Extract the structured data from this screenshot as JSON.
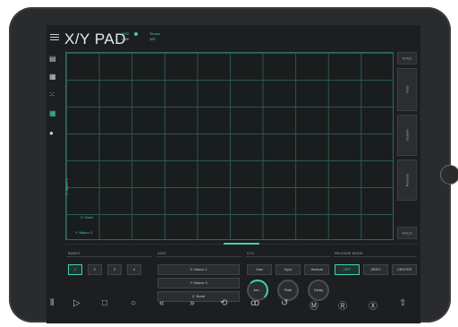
{
  "header": {
    "title": "X/Y PAD",
    "status_label": "MIDI",
    "status_value": "LIVE",
    "tempo_label": "Tempo",
    "tempo_value": "127"
  },
  "sidebar": {
    "icons": [
      "grid-icon",
      "grid-dots-icon",
      "hex-grid-icon",
      "xy-pad-icon",
      "record-dot-icon"
    ]
  },
  "pad": {
    "x_axis_label": "X: None",
    "y_axis_label": "Y: Macro 3",
    "y_axis_vertical": "Y: Macro 1"
  },
  "right_buttons": [
    {
      "label": "SYNC"
    },
    {
      "label": "Hold"
    },
    {
      "label": "Sustain"
    },
    {
      "label": "Release"
    },
    {
      "label": "HOLD"
    }
  ],
  "panels": {
    "banks": {
      "label": "BANKS",
      "buttons": [
        "1",
        "2",
        "3",
        "4"
      ]
    },
    "axis": {
      "label": "AXIS",
      "buttons": [
        "X: Macro 1",
        "Y: Macro 3",
        "Z: None"
      ]
    },
    "lfo": {
      "label": "LFO",
      "buttons": [
        "Saw",
        "Sync",
        "Vertical"
      ],
      "knobs": [
        "Am...",
        "Rate",
        "Delay"
      ]
    },
    "release_mode": {
      "label": "RELEASE MODE",
      "buttons": [
        "OFF",
        "ZERO",
        "CENTER"
      ]
    }
  },
  "accent_color": "#3fd1b0"
}
